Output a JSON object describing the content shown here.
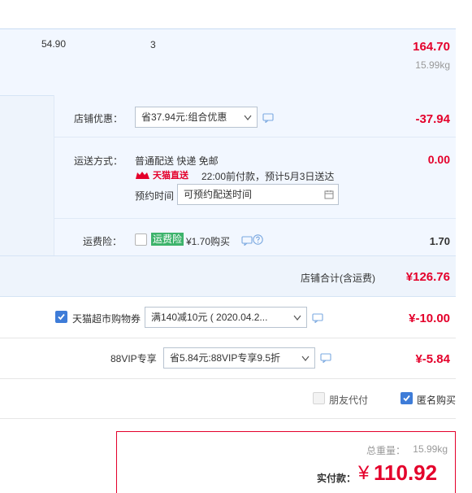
{
  "item": {
    "unit_price": "54.90",
    "quantity": "3",
    "subtotal": "164.70",
    "weight": "15.99kg"
  },
  "store": {
    "discount": {
      "label": "店铺优惠：",
      "select_value": "省37.94元:组合优惠",
      "amount": "-37.94"
    },
    "shipping": {
      "label": "运送方式：",
      "method": "普通配送 快递 免邮",
      "badge": "天猫直送",
      "delivery_note": "22:00前付款，预计5月3日送达",
      "reserve_label": "预约时间",
      "reserve_placeholder": "可预约配送时间",
      "amount": "0.00"
    },
    "insurance": {
      "label": "运费险：",
      "tag": "运费险",
      "price_text": "¥1.70购买",
      "amount": "1.70"
    },
    "total": {
      "label": "店铺合计(含运费)",
      "amount": "¥126.76"
    }
  },
  "coupon": {
    "label": "天猫超市购物券",
    "select_value": "满140减10元 ( 2020.04.2...",
    "amount": "¥-10.00",
    "checked": true
  },
  "vip": {
    "label": "88VIP专享",
    "select_value": "省5.84元:88VIP专享9.5折",
    "amount": "¥-5.84"
  },
  "options": {
    "friend_pay": "朋友代付",
    "anonymous": "匿名购买"
  },
  "payment": {
    "weight_label": "总重量：",
    "weight_value": "15.99kg",
    "actual_label": "实付款：",
    "currency": "¥",
    "amount": "110.92"
  },
  "colors": {
    "accent_red": "#e4002b",
    "checkbox_blue": "#3e7cd8",
    "tag_green": "#3db36b"
  },
  "icons": [
    "chevron-down-icon",
    "message-icon",
    "help-icon",
    "calendar-icon",
    "check-icon",
    "tmall-cat-icon"
  ]
}
